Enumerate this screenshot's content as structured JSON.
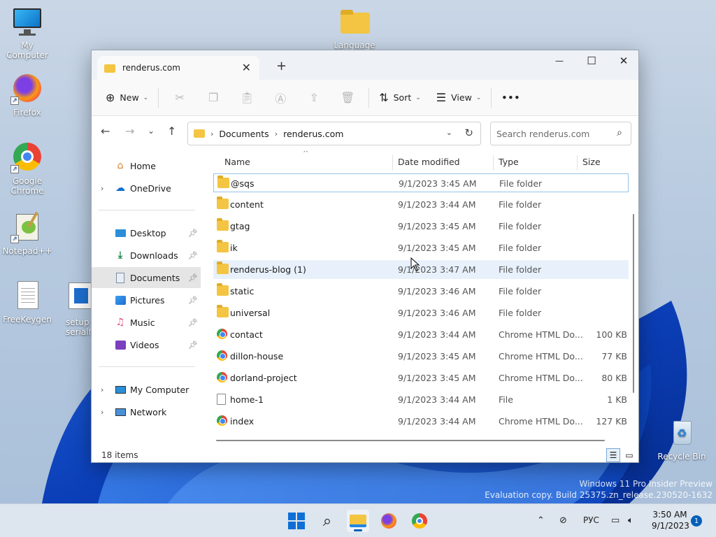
{
  "desktop": {
    "icons": [
      {
        "name": "My Computer"
      },
      {
        "name": "Language"
      },
      {
        "name": "Firefox"
      },
      {
        "name": "Google Chrome"
      },
      {
        "name": "Notepad++"
      },
      {
        "name": "FreeKeygen"
      },
      {
        "name": "setup serialfr"
      },
      {
        "name": "Recycle Bin"
      }
    ],
    "watermark_line1": "Windows 11 Pro Insider Preview",
    "watermark_line2": "Evaluation copy. Build 25375.zn_release.230520-1632"
  },
  "window": {
    "tab_title": "renderus.com",
    "close_tab": "✕",
    "new_tab": "+",
    "controls": {
      "minimize": "—",
      "maximize": "☐",
      "close": "✕"
    },
    "commandbar": {
      "new_label": "New",
      "sort_label": "Sort",
      "view_label": "View",
      "more_label": "•••"
    },
    "address": {
      "crumbs": [
        "Documents",
        "renderus.com"
      ],
      "search_placeholder": "Search renderus.com"
    },
    "nav": {
      "items": [
        {
          "label": "Home"
        },
        {
          "label": "OneDrive"
        },
        {
          "label": "Desktop"
        },
        {
          "label": "Downloads"
        },
        {
          "label": "Documents"
        },
        {
          "label": "Pictures"
        },
        {
          "label": "Music"
        },
        {
          "label": "Videos"
        },
        {
          "label": "My Computer"
        },
        {
          "label": "Network"
        }
      ]
    },
    "columns": {
      "name": "Name",
      "date": "Date modified",
      "type": "Type",
      "size": "Size"
    },
    "files": [
      {
        "name": "@sqs",
        "date": "9/1/2023 3:45 AM",
        "type": "File folder",
        "size": "",
        "kind": "folder"
      },
      {
        "name": "content",
        "date": "9/1/2023 3:44 AM",
        "type": "File folder",
        "size": "",
        "kind": "folder"
      },
      {
        "name": "gtag",
        "date": "9/1/2023 3:45 AM",
        "type": "File folder",
        "size": "",
        "kind": "folder"
      },
      {
        "name": "ik",
        "date": "9/1/2023 3:45 AM",
        "type": "File folder",
        "size": "",
        "kind": "folder"
      },
      {
        "name": "renderus-blog (1)",
        "date": "9/1/2023 3:47 AM",
        "type": "File folder",
        "size": "",
        "kind": "folder"
      },
      {
        "name": "static",
        "date": "9/1/2023 3:46 AM",
        "type": "File folder",
        "size": "",
        "kind": "folder"
      },
      {
        "name": "universal",
        "date": "9/1/2023 3:46 AM",
        "type": "File folder",
        "size": "",
        "kind": "folder"
      },
      {
        "name": "contact",
        "date": "9/1/2023 3:44 AM",
        "type": "Chrome HTML Do...",
        "size": "100 KB",
        "kind": "chrome"
      },
      {
        "name": "dillon-house",
        "date": "9/1/2023 3:45 AM",
        "type": "Chrome HTML Do...",
        "size": "77 KB",
        "kind": "chrome"
      },
      {
        "name": "dorland-project",
        "date": "9/1/2023 3:45 AM",
        "type": "Chrome HTML Do...",
        "size": "80 KB",
        "kind": "chrome"
      },
      {
        "name": "home-1",
        "date": "9/1/2023 3:44 AM",
        "type": "File",
        "size": "1 KB",
        "kind": "file"
      },
      {
        "name": "index",
        "date": "9/1/2023 3:44 AM",
        "type": "Chrome HTML Do...",
        "size": "127 KB",
        "kind": "chrome"
      }
    ],
    "status_text": "18 items"
  },
  "taskbar": {
    "tray_lang": "РУС",
    "time": "3:50 AM",
    "date": "9/1/2023",
    "notif_count": "1"
  }
}
